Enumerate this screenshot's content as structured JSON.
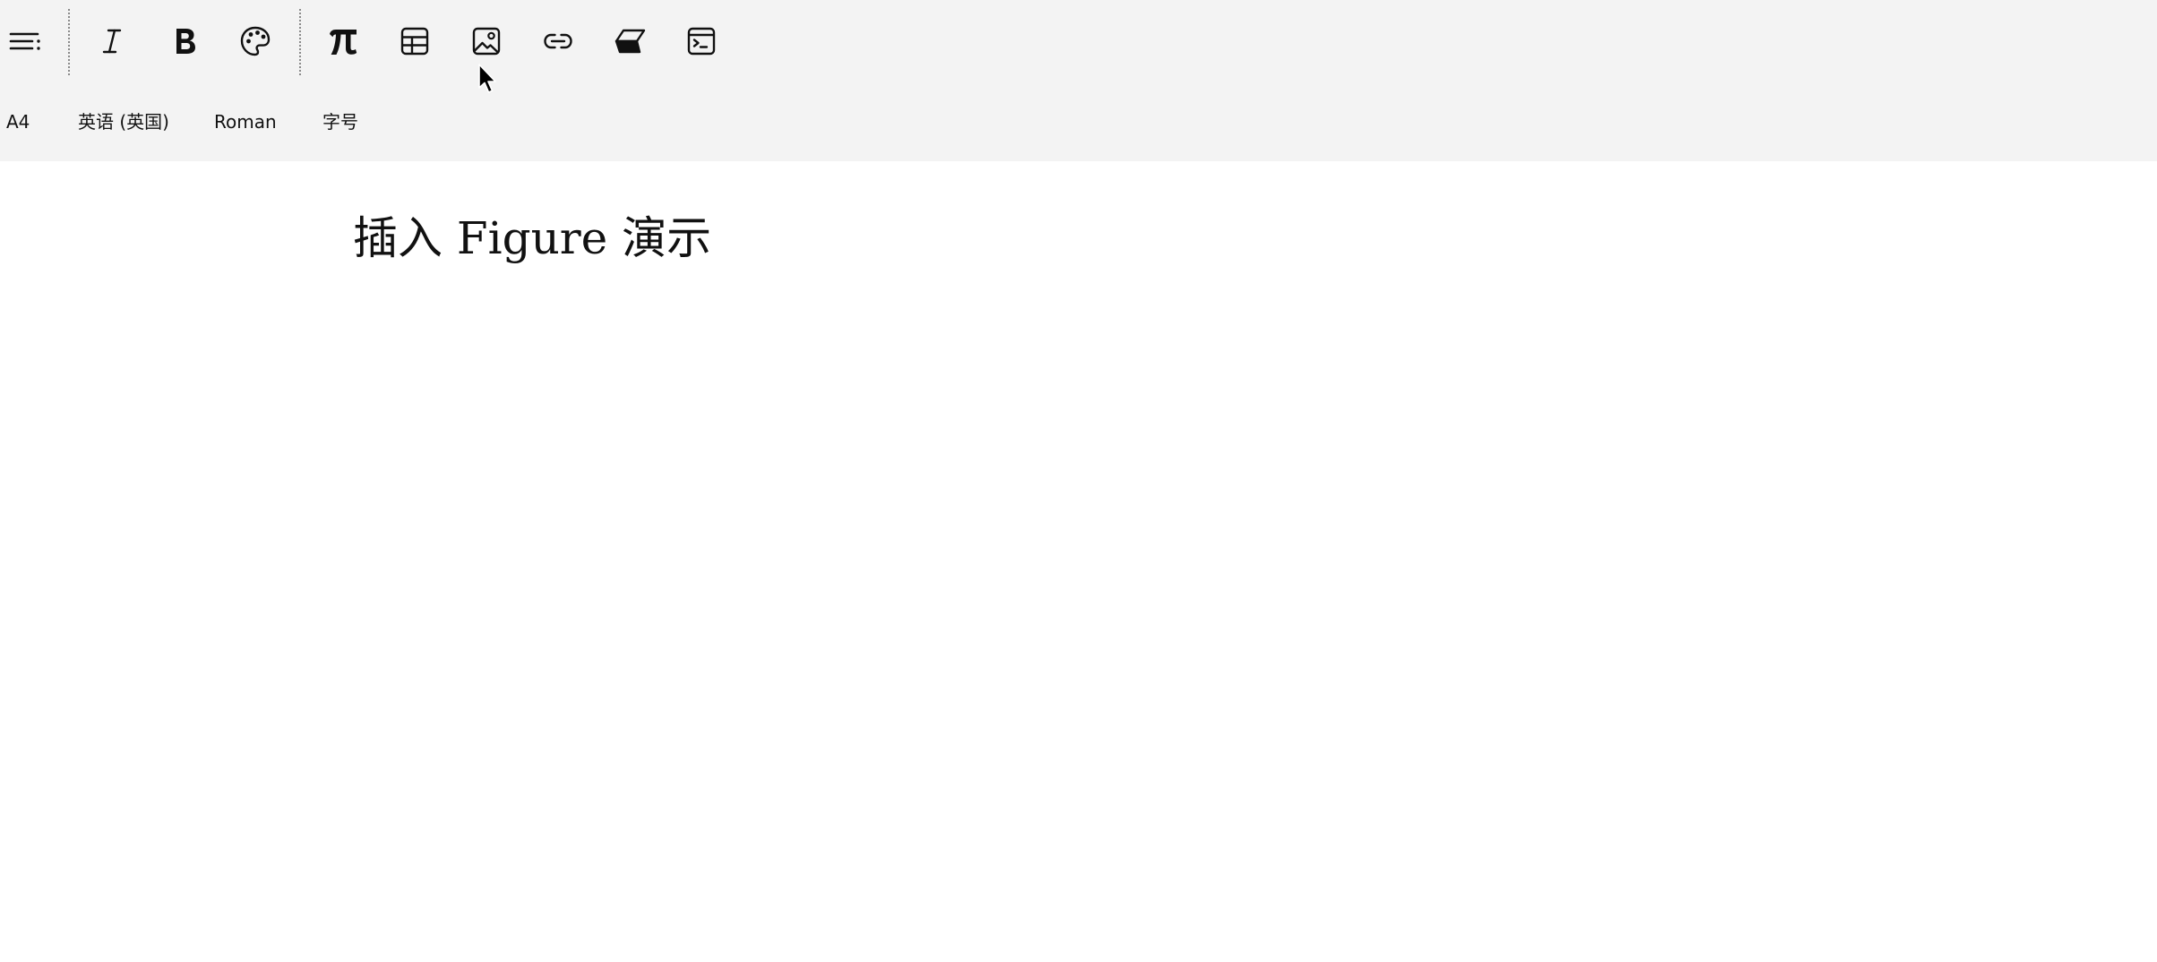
{
  "toolbar": {
    "icons": [
      "menu-icon",
      "italic-icon",
      "bold-icon",
      "palette-icon",
      "pi-icon",
      "table-icon",
      "image-icon",
      "link-icon",
      "eraser-icon",
      "terminal-icon"
    ],
    "paper_size": "A4",
    "language": "英语 (英国)",
    "font": "Roman",
    "font_size": "字号"
  },
  "document": {
    "title": "插入 Figure 演示"
  }
}
